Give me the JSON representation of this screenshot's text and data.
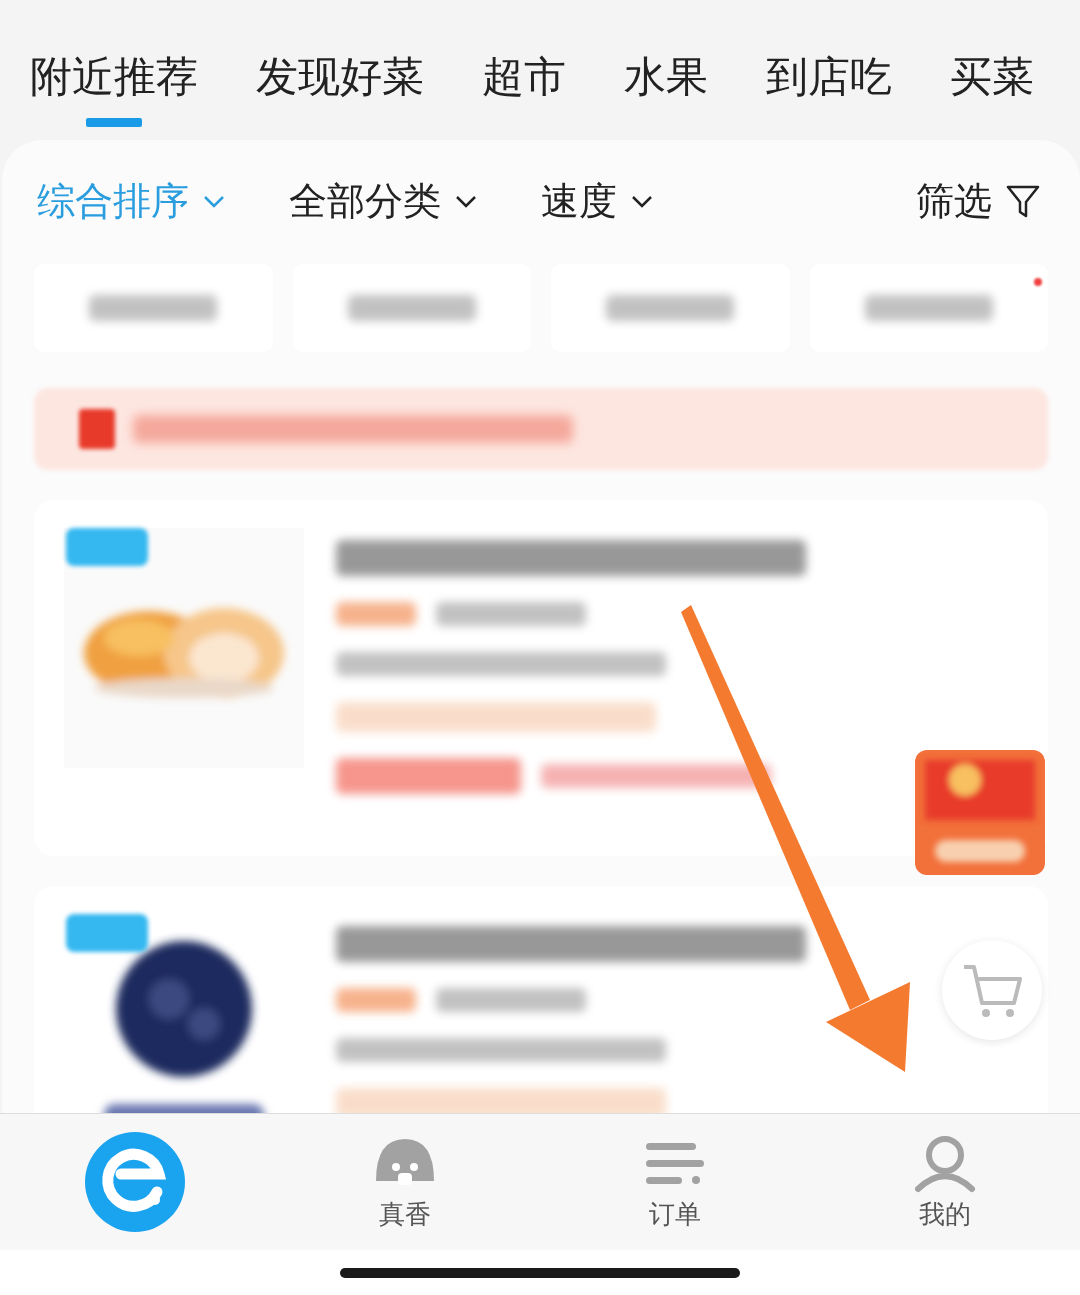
{
  "tabs": [
    {
      "label": "附近推荐",
      "selected": true
    },
    {
      "label": "发现好菜",
      "selected": false
    },
    {
      "label": "超市",
      "selected": false
    },
    {
      "label": "水果",
      "selected": false
    },
    {
      "label": "到店吃",
      "selected": false
    },
    {
      "label": "买菜",
      "selected": false
    }
  ],
  "filters": [
    {
      "label": "综合排序",
      "kind": "dropdown",
      "selected": true
    },
    {
      "label": "全部分类",
      "kind": "dropdown",
      "selected": false
    },
    {
      "label": "速度",
      "kind": "dropdown",
      "selected": false
    },
    {
      "label": "筛选",
      "kind": "filter",
      "selected": false
    }
  ],
  "bottom_nav": [
    {
      "kind": "home",
      "selected": true
    },
    {
      "kind": "bowl",
      "label": "真香",
      "selected": false
    },
    {
      "kind": "list",
      "label": "订单",
      "selected": false
    },
    {
      "kind": "person",
      "label": "我的",
      "selected": false
    }
  ]
}
